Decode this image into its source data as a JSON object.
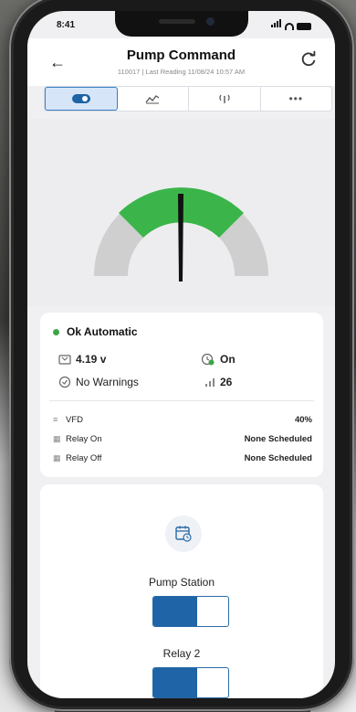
{
  "status_bar": {
    "time": "8:41"
  },
  "header": {
    "title": "Pump Command",
    "subtitle": "110017 | Last Reading 11/08/24 10:57 AM"
  },
  "tabs": [
    {
      "icon": "toggle-icon",
      "active": true
    },
    {
      "icon": "chart-icon",
      "active": false
    },
    {
      "icon": "signal-tower-icon",
      "active": false
    },
    {
      "icon": "more-icon",
      "active": false
    }
  ],
  "gauge": {
    "level_percent": 40
  },
  "status": {
    "state": "Ok Automatic",
    "voltage": "4.19 v",
    "power": "On",
    "warnings": "No Warnings",
    "signal": "26"
  },
  "details": [
    {
      "label": "VFD",
      "value": "40%"
    },
    {
      "label": "Relay On",
      "value": "None Scheduled"
    },
    {
      "label": "Relay Off",
      "value": "None Scheduled"
    }
  ],
  "controls": {
    "pump_station_label": "Pump Station",
    "relay2_label": "Relay 2"
  },
  "colors": {
    "accent": "#1e64a6",
    "ok_green": "#3aa548",
    "gauge_green": "#3bb54a",
    "gauge_grey": "#cfcfcf"
  }
}
